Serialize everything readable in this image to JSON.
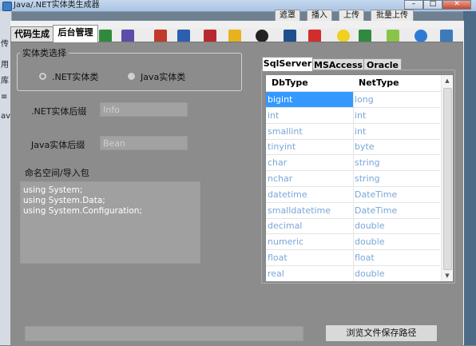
{
  "window": {
    "title": "Java/.NET实体类生成器"
  },
  "background": {
    "tabs": [
      "遮罩",
      "播入",
      "上传",
      "批量上传"
    ],
    "left_fragments": [
      "传",
      "用",
      "库",
      "≡",
      "ava"
    ]
  },
  "main_tabs": [
    {
      "label": "代码生成",
      "active": false
    },
    {
      "label": "后台管理",
      "active": true
    }
  ],
  "toolbar_icons": [
    "excel-icon",
    "vs-icon",
    "text-icon",
    "doc-icon",
    "swf-icon",
    "folder-icon",
    "media-icon",
    "photoshop-icon",
    "pdf-icon",
    "help-icon",
    "excel-icon",
    "android-icon",
    "edge-icon",
    "monitor-icon"
  ],
  "entity_group": {
    "title": "实体类选择",
    "options": [
      {
        "label": ".NET实体类",
        "selected": true
      },
      {
        "label": "Java实体类",
        "selected": false
      }
    ]
  },
  "net_suffix": {
    "label": ".NET实体后缀",
    "value": "Info"
  },
  "java_suffix": {
    "label": "Java实体后缀",
    "value": "Bean"
  },
  "namespace": {
    "label": "命名空间/导入包",
    "lines": [
      "using System;",
      "using System.Data;",
      "using System.Configuration;"
    ]
  },
  "db_tabs": [
    {
      "label": "SqlServer",
      "active": true
    },
    {
      "label": "MSAccess",
      "active": false
    },
    {
      "label": "Oracle",
      "active": false
    }
  ],
  "type_grid": {
    "columns": [
      "DbType",
      "NetType"
    ],
    "rows": [
      [
        "bigint",
        "long"
      ],
      [
        "int",
        "int"
      ],
      [
        "smallint",
        "int"
      ],
      [
        "tinyint",
        "byte"
      ],
      [
        "char",
        "string"
      ],
      [
        "nchar",
        "string"
      ],
      [
        "datetime",
        "DateTime"
      ],
      [
        "smalldatetime",
        "DateTime"
      ],
      [
        "decimal",
        "double"
      ],
      [
        "numeric",
        "double"
      ],
      [
        "float",
        "float"
      ],
      [
        "real",
        "double"
      ]
    ]
  },
  "browse_button": {
    "label": "浏览文件保存路径"
  },
  "colors": {
    "selection": "#3399ff",
    "cell_text": "#7aa6d8",
    "panel": "#8c8c8c"
  }
}
